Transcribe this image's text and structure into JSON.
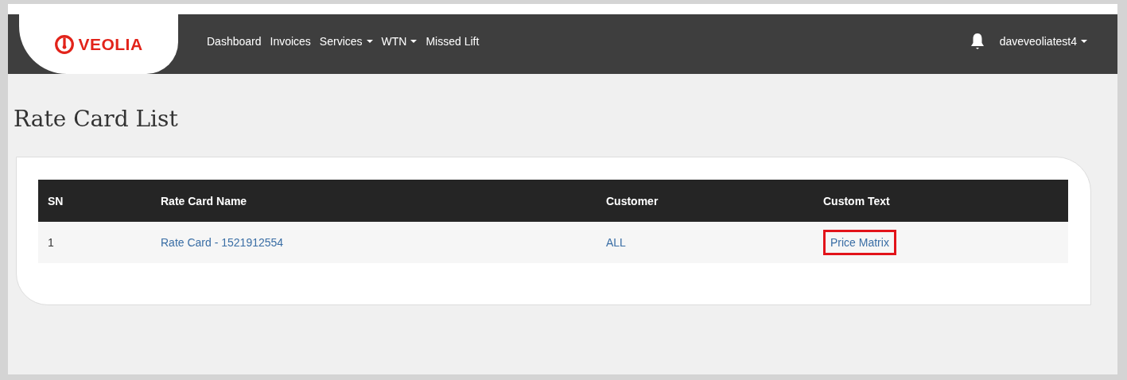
{
  "logo": {
    "text": "VEOLIA"
  },
  "nav": [
    {
      "label": "Dashboard",
      "dropdown": false
    },
    {
      "label": "Invoices",
      "dropdown": false
    },
    {
      "label": "Services",
      "dropdown": true
    },
    {
      "label": "WTN",
      "dropdown": true
    },
    {
      "label": "Missed Lift",
      "dropdown": false
    }
  ],
  "user": {
    "name": "daveveoliatest4",
    "dropdown": true
  },
  "page_title": "Rate Card List",
  "table": {
    "columns": [
      "SN",
      "Rate Card Name",
      "Customer",
      "Custom Text"
    ],
    "rows": [
      {
        "cells": [
          {
            "text": "1",
            "kind": "text",
            "highlighted": false
          },
          {
            "text": "Rate Card - 1521912554",
            "kind": "link",
            "highlighted": false
          },
          {
            "text": "ALL",
            "kind": "link",
            "highlighted": false
          },
          {
            "text": "Price Matrix",
            "kind": "link",
            "highlighted": true
          }
        ]
      }
    ]
  }
}
